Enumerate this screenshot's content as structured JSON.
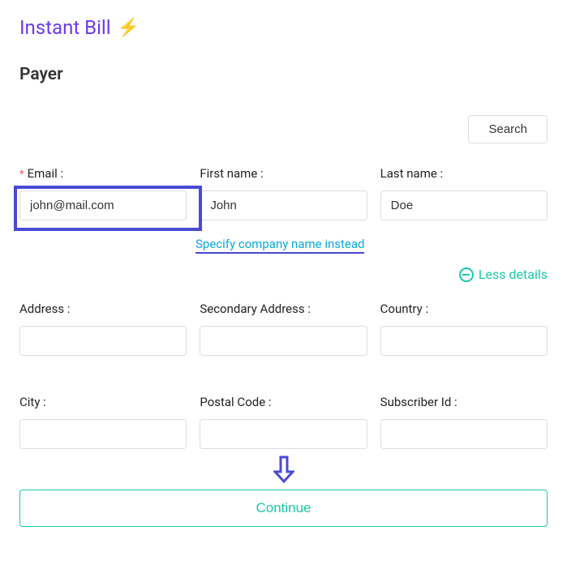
{
  "header": {
    "title": "Instant Bill",
    "bolt_emoji": "⚡"
  },
  "section": {
    "heading": "Payer"
  },
  "actions": {
    "search_label": "Search",
    "continue_label": "Continue"
  },
  "fields": {
    "email": {
      "label": "Email :",
      "value": "john@mail.com",
      "required": true
    },
    "first_name": {
      "label": "First name :",
      "value": "John"
    },
    "last_name": {
      "label": "Last name :",
      "value": "Doe"
    },
    "address": {
      "label": "Address :",
      "value": ""
    },
    "secondary_address": {
      "label": "Secondary Address :",
      "value": ""
    },
    "country": {
      "label": "Country :",
      "value": ""
    },
    "city": {
      "label": "City :",
      "value": ""
    },
    "postal_code": {
      "label": "Postal Code :",
      "value": ""
    },
    "subscriber_id": {
      "label": "Subscriber Id :",
      "value": ""
    }
  },
  "links": {
    "company_name": "Specify company name instead",
    "less_details": "Less details"
  },
  "colors": {
    "primary_purple": "#6c3ce9",
    "highlight_blue": "#4a4ad4",
    "link_blue": "#09a9e0",
    "accent_teal": "#1bc9a8"
  }
}
